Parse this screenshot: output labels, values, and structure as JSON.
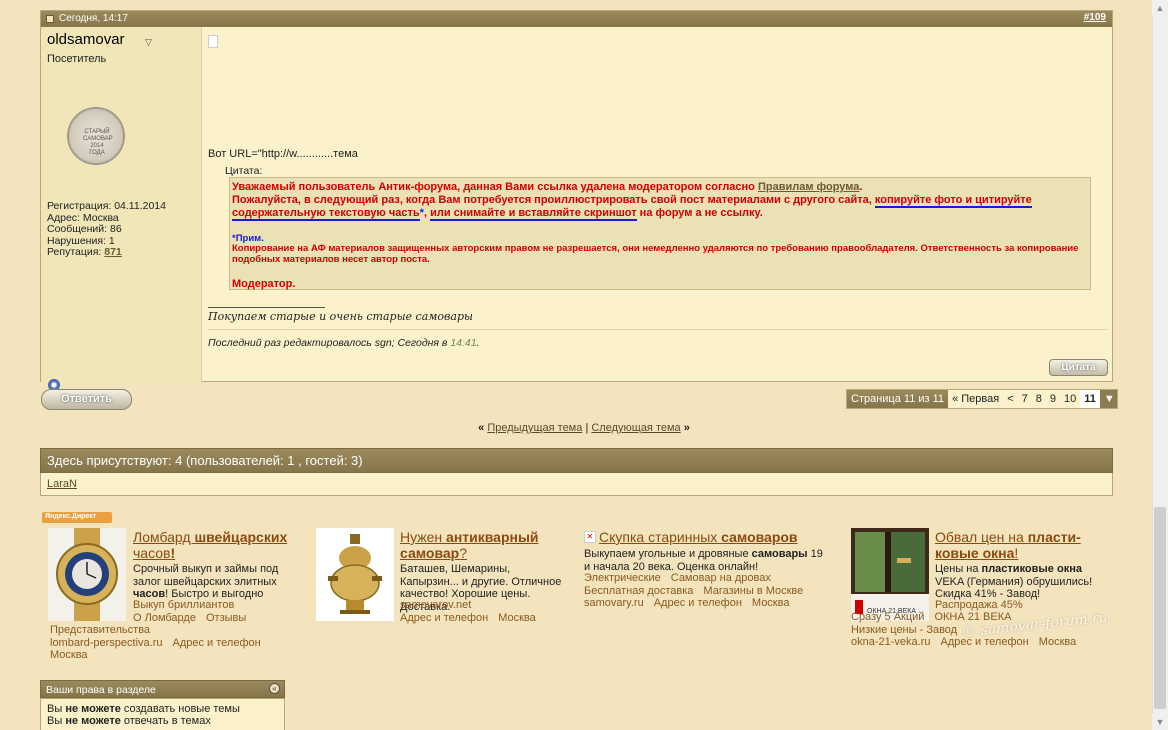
{
  "post": {
    "date": "Сегодня, 14:17",
    "number": "#109",
    "username": "oldsamovar",
    "usertitle": "Посетитель",
    "avatar_text": "СТАРЫЙ САМОВАР 2014 ГОДА",
    "user_info": [
      "Регистрация: 04.11.2014",
      "Адрес: Москва",
      "Сообщений: 86",
      "Нарушения: 1"
    ],
    "reputation_label": "Репутация: ",
    "reputation_value": "871",
    "url_line": "Вот URL=\"http://w............тема",
    "quote_label": "Цитата:",
    "quote": {
      "p1_a": "Уважаемый пользователь Антик-форума, данная Вами ссылка удалена модератором согласно ",
      "p1_link": "Правилам форума",
      "p1_b": ".",
      "p2_a": "Пожалуйста, в следующий раз, когда Вам потребуется проиллюстрировать свой пост материалами с другого сайта, ",
      "p2_u1": "копируйте фото и цитируйте содержательную текстовую часть",
      "p2_star": "*",
      "p2_comma": ", ",
      "p2_u2": "или снимайте и вставляйте скриншот",
      "p2_b": " на форум а не ссылку.",
      "note_label": "*Прим.",
      "note": "Копирование на АФ материалов защищенных авторским правом не разрешается, они немедленно удаляются по требованию правообладателя. Ответственность за копирование подобных материалов несет автор поста.",
      "moderator": "Модератор."
    },
    "signature": "Покупаем старые и очень старые самовары",
    "edited_prefix": "Последний раз редактировалось sgn; Сегодня в ",
    "edited_time": "14:41",
    "edited_suffix": ".",
    "quote_button": "Цитата"
  },
  "reply_button": "Ответить",
  "pager": {
    "label": "Страница 11 из 11",
    "first": "« Первая",
    "prev": "<",
    "pages": [
      "7",
      "8",
      "9",
      "10"
    ],
    "current": "11",
    "arrow": "▼"
  },
  "thread_nav": {
    "prev_mark": "«",
    "prev": "Предыдущая тема",
    "sep": "|",
    "next": "Следующая тема",
    "next_mark": "»"
  },
  "present": {
    "header": "Здесь присутствуют: 4 (пользователей: 1 , гостей: 3)",
    "user": "LaraN"
  },
  "yandex_badge": "Яндекс.Директ",
  "ads": [
    {
      "title_a": "Ломбард ",
      "title_b": "швейцарских",
      "title_c": " часов",
      "title_d": "!",
      "text_html_a": "Срочный выкуп и займы под залог швейцарских элитных ",
      "text_b": "часов",
      "text_c": "! Быстро и выгодно",
      "links1": [
        "Выкуп бриллиантов"
      ],
      "links2": [
        "О Ломбарде",
        "Отзывы"
      ],
      "links3": [
        "Представительства"
      ],
      "domain": "lombard-perspectiva.ru",
      "extra": [
        "Адрес и телефон"
      ],
      "city": "Москва"
    },
    {
      "title_a": "Нужен ",
      "title_b": "антикварный самовар",
      "title_c": "?",
      "text": "Баташев, Шемарины, Капырзин... и другие. Отличное качество! Хорошие цены. Доставка.",
      "domain": "samovarov.net",
      "links": [
        "Адрес и телефон",
        "Москва"
      ]
    },
    {
      "title_a": "Скупка старинных ",
      "title_b": "самоваров",
      "text_a": "Выкупаем угольные и дровяные ",
      "text_b": "самовары",
      "text_c": " 19 и начала 20 века. Оценка онлайн!",
      "links1": [
        "Электрические",
        "Самовар на дровах"
      ],
      "links2": [
        "Бесплатная доставка",
        "Магазины в Москве"
      ],
      "domain": "samovary.ru",
      "links3": [
        "Адрес и телефон",
        "Москва"
      ]
    },
    {
      "title_a": "Обвал цен на ",
      "title_b": "пласти-ковые окна",
      "title_c": "!",
      "text_a": "Цены на ",
      "text_b": "пластиковые окна",
      "text_c": " VEKA (Германия) обрушились! Скидка 41% - Завод!",
      "links1": [
        "Распродажа 45%"
      ],
      "links2": [
        "Сразу 5 Акций",
        "ОКНА 21 ВЕКА"
      ],
      "links3": [
        "Низкие цены - Завод"
      ],
      "domain": "okna-21-veka.ru",
      "links4": [
        "Адрес и телефон",
        "Москва"
      ],
      "img_caption": "ОКНА 21 ВЕКА"
    }
  ],
  "watermark": "© samovar-forum.ru",
  "rights": {
    "header": "Ваши права в разделе",
    "line1_a": "Вы ",
    "line1_b": "не можете",
    "line1_c": " создавать новые темы",
    "line2_a": "Вы ",
    "line2_b": "не можете",
    "line2_c": " отвечать в темах"
  },
  "colors": {
    "page_bg": "#f3e4bd",
    "header_bg": "#8f7f52",
    "quote_red": "#d40000",
    "quote_blue": "#1a1adc"
  }
}
